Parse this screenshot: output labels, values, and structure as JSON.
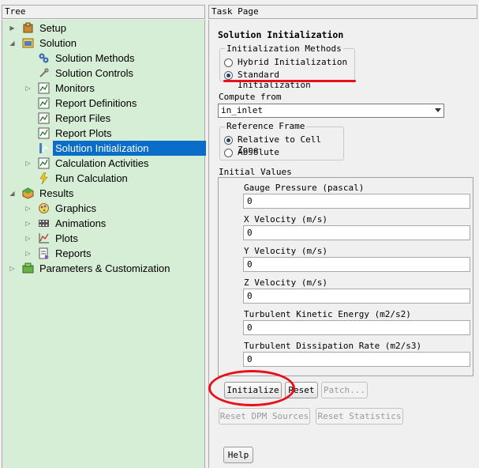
{
  "tree": {
    "header": "Tree",
    "items": [
      {
        "label": "Setup",
        "icon": "setup-icon",
        "expander": "▶"
      },
      {
        "label": "Solution",
        "icon": "solution-icon",
        "expander": "◢"
      },
      {
        "label": "Solution Methods",
        "icon": "methods-icon",
        "expander": ""
      },
      {
        "label": "Solution Controls",
        "icon": "controls-icon",
        "expander": ""
      },
      {
        "label": "Monitors",
        "icon": "monitors-icon",
        "expander": "▷"
      },
      {
        "label": "Report Definitions",
        "icon": "report-definitions-icon",
        "expander": ""
      },
      {
        "label": "Report Files",
        "icon": "report-files-icon",
        "expander": ""
      },
      {
        "label": "Report Plots",
        "icon": "report-plots-icon",
        "expander": ""
      },
      {
        "label": "Solution Initialization",
        "icon": "initialization-icon",
        "expander": ""
      },
      {
        "label": "Calculation Activities",
        "icon": "calculation-activities-icon",
        "expander": "▷"
      },
      {
        "label": "Run Calculation",
        "icon": "run-calculation-icon",
        "expander": ""
      },
      {
        "label": "Results",
        "icon": "results-icon",
        "expander": "◢"
      },
      {
        "label": "Graphics",
        "icon": "graphics-icon",
        "expander": "▷"
      },
      {
        "label": "Animations",
        "icon": "animations-icon",
        "expander": "▷"
      },
      {
        "label": "Plots",
        "icon": "plots-icon",
        "expander": "▷"
      },
      {
        "label": "Reports",
        "icon": "reports-icon",
        "expander": "▷"
      },
      {
        "label": "Parameters & Customization",
        "icon": "parameters-icon",
        "expander": "▷"
      }
    ],
    "selected_index": 8
  },
  "task": {
    "header": "Task Page",
    "title": "Solution Initialization",
    "methods": {
      "legend": "Initialization Methods",
      "options": [
        "Hybrid  Initialization",
        "Standard Initialization"
      ],
      "selected": 1
    },
    "compute_from": {
      "label": "Compute from",
      "value": "in_inlet"
    },
    "reference_frame": {
      "legend": "Reference Frame",
      "options": [
        "Relative to Cell Zone",
        "Absolute"
      ],
      "selected": 0
    },
    "initial_values": {
      "label": "Initial Values",
      "fields": [
        {
          "label": "Gauge Pressure (pascal)",
          "value": "0"
        },
        {
          "label": "X Velocity (m/s)",
          "value": "0"
        },
        {
          "label": "Y Velocity (m/s)",
          "value": "0"
        },
        {
          "label": "Z Velocity (m/s)",
          "value": "0"
        },
        {
          "label": "Turbulent Kinetic Energy (m2/s2)",
          "value": "0"
        },
        {
          "label": "Turbulent Dissipation Rate (m2/s3)",
          "value": "0"
        }
      ]
    },
    "buttons": {
      "initialize": "Initialize",
      "reset": "Reset",
      "patch": "Patch...",
      "reset_dpm": "Reset DPM Sources",
      "reset_statistics": "Reset Statistics",
      "help": "Help"
    },
    "annotation_color": "#e8101a",
    "selection_color": "#0a6ec8",
    "tree_background": "#d6edd6"
  }
}
